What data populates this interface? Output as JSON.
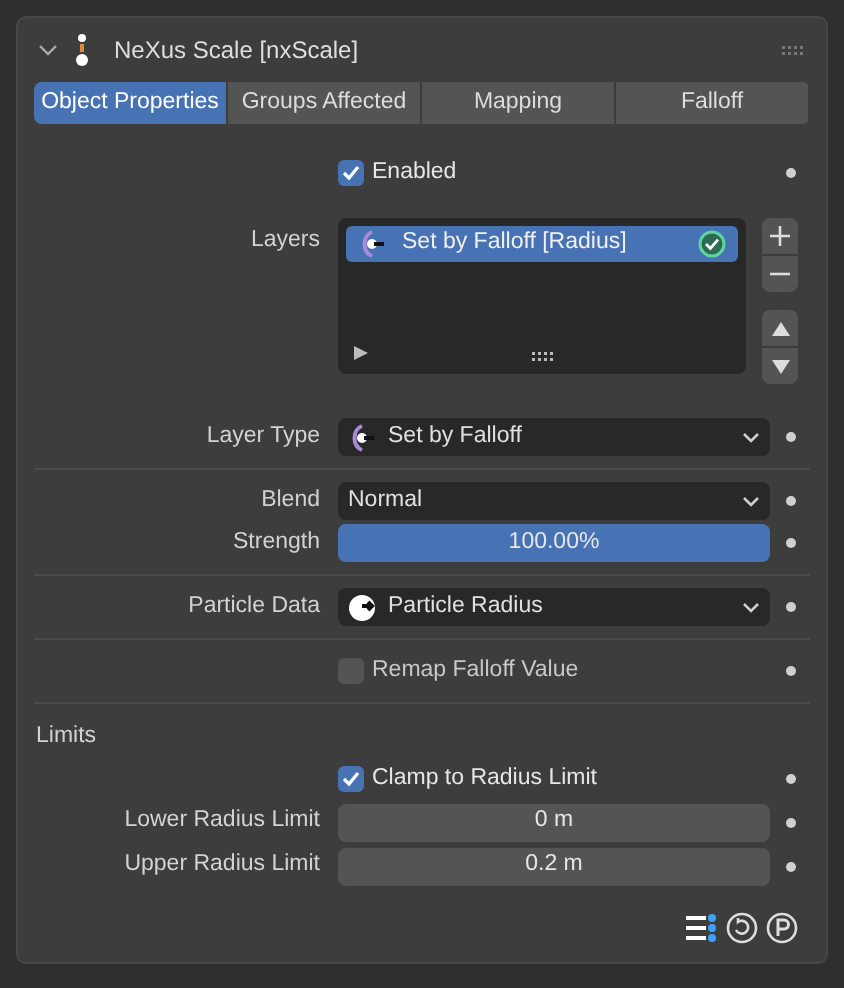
{
  "panel": {
    "title": "NeXus Scale [nxScale]",
    "expanded": true
  },
  "tabs": [
    {
      "label": "Object Properties",
      "selected": true
    },
    {
      "label": "Groups Affected",
      "selected": false
    },
    {
      "label": "Mapping",
      "selected": false
    },
    {
      "label": "Falloff",
      "selected": false
    }
  ],
  "rows": [
    {
      "kind": "checkbox",
      "label": "Enabled",
      "checked": true
    },
    {
      "kind": "list",
      "label": "Layers",
      "items": [
        {
          "name": "Set by Falloff [Radius]",
          "selected": true,
          "enabled": true
        }
      ]
    },
    {
      "kind": "falloffselect",
      "label": "Layer Type",
      "value": "Set by Falloff"
    },
    {
      "kind": "divider"
    },
    {
      "kind": "dropdown",
      "label": "Blend",
      "value": "Normal"
    },
    {
      "kind": "slider",
      "label": "Strength",
      "reading": "100.00%",
      "level": 1.0
    },
    {
      "kind": "divider"
    },
    {
      "kind": "particleselect",
      "label": "Particle Data",
      "value": "Particle Radius"
    },
    {
      "kind": "divider"
    },
    {
      "kind": "checkbox",
      "label": "Remap Falloff Value",
      "checked": false
    },
    {
      "kind": "divider"
    },
    {
      "kind": "heading",
      "label": "Limits"
    },
    {
      "kind": "checkbox",
      "label": "Clamp to Radius Limit",
      "checked": true
    },
    {
      "kind": "number",
      "label": "Lower Radius Limit",
      "value": "0 m"
    },
    {
      "kind": "number",
      "label": "Upper Radius Limit",
      "value": "0.2 m"
    }
  ]
}
